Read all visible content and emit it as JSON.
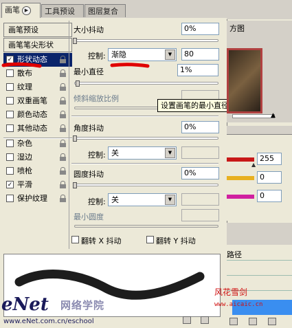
{
  "tabs": [
    {
      "label": "画笔",
      "active": true
    },
    {
      "label": "工具预设",
      "active": false
    },
    {
      "label": "图层复合",
      "active": false
    }
  ],
  "brush_presets_label": "画笔预设",
  "brush_tip_shape_label": "画笔笔尖形状",
  "options": [
    {
      "label": "形状动态",
      "checked": true,
      "selected": true
    },
    {
      "label": "散布",
      "checked": false
    },
    {
      "label": "纹理",
      "checked": false
    },
    {
      "label": "双重画笔",
      "checked": false
    },
    {
      "label": "颜色动态",
      "checked": false
    },
    {
      "label": "其他动态",
      "checked": false
    },
    {
      "label": "杂色",
      "checked": false
    },
    {
      "label": "湿边",
      "checked": false
    },
    {
      "label": "喷枪",
      "checked": false
    },
    {
      "label": "平滑",
      "checked": true
    },
    {
      "label": "保护纹理",
      "checked": false
    }
  ],
  "settings": {
    "size_jitter": {
      "label": "大小抖动",
      "value": "0%"
    },
    "control1": {
      "label": "控制:",
      "selected": "渐隐",
      "value": "80"
    },
    "min_diameter": {
      "label": "最小直径",
      "value": "1%"
    },
    "tilt_scale": {
      "label": "倾斜缩放比例",
      "value": ""
    },
    "angle_jitter": {
      "label": "角度抖动",
      "value": "0%"
    },
    "control2": {
      "label": "控制:",
      "selected": "关"
    },
    "roundness_jitter": {
      "label": "圆度抖动",
      "value": "0%"
    },
    "control3": {
      "label": "控制:",
      "selected": "关"
    },
    "min_roundness": {
      "label": "最小圆度",
      "value": ""
    },
    "flip_x": {
      "label": "翻转 X 抖动",
      "checked": false
    },
    "flip_y": {
      "label": "翻转 Y 抖动",
      "checked": false
    }
  },
  "tooltip": "设置画笔的最小直径",
  "right_panels": {
    "histogram_tab": "方图",
    "color_values": [
      "255",
      "0",
      "0"
    ],
    "paths_label": "路径"
  },
  "watermark": {
    "logo": "eNet",
    "logo_cn": "网络学院",
    "url": "www.eNet.com.cn/eschool",
    "author": "风花雪剑",
    "author_url": "www.aicaic.cn"
  },
  "colors": {
    "selection_blue": "#0a246a",
    "annotation_red": "#e00000",
    "red_bar": "#c81818",
    "yellow_bar": "#e8b020",
    "magenta_bar": "#d020a0"
  }
}
